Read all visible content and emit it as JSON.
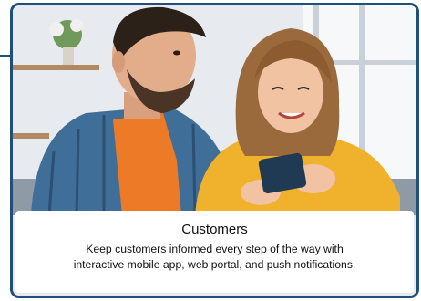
{
  "card": {
    "title": "Customers",
    "description_line1": "Keep customers informed every step of the way with",
    "description_line2": "interactive mobile app, web portal, and push notifications."
  },
  "colors": {
    "border": "#1f4f7a",
    "caption_bg": "#ffffff",
    "text": "#111111"
  }
}
